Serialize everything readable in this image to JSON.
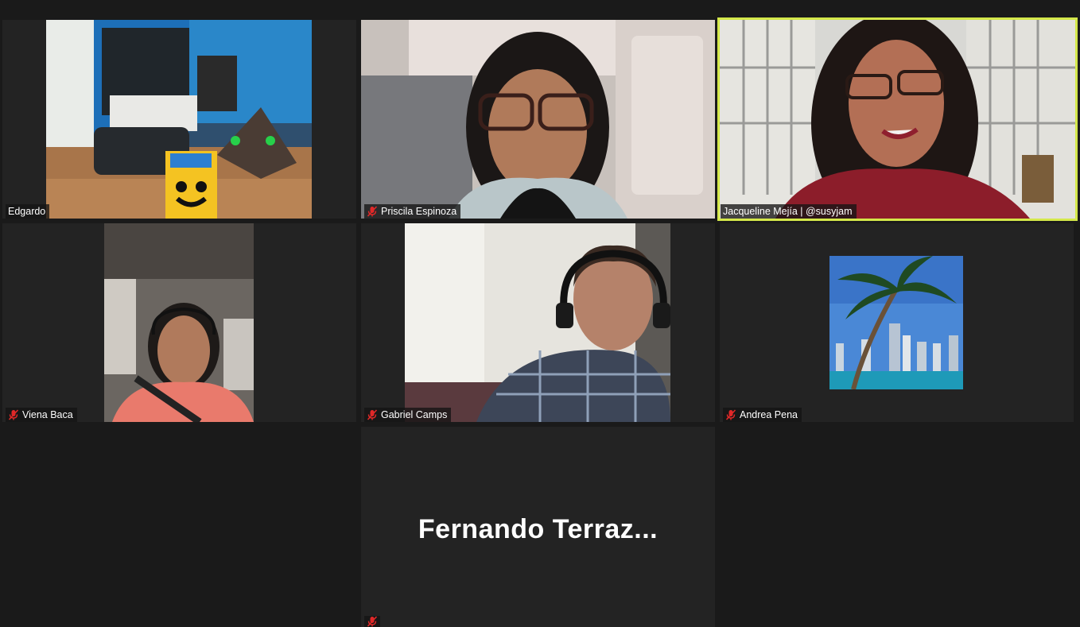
{
  "participants": [
    {
      "name": "Edgardo",
      "muted": false
    },
    {
      "name": "Priscila Espinoza",
      "muted": true
    },
    {
      "name": "Jacqueline Mejía | @susyjam",
      "muted": false,
      "active_speaker": true
    },
    {
      "name": "Viena Baca",
      "muted": true
    },
    {
      "name": "Gabriel Camps",
      "muted": true
    },
    {
      "name": "Andrea Pena",
      "muted": true
    },
    {
      "name": "Fernando  Terraz...",
      "muted": true,
      "video_off": true
    }
  ],
  "colors": {
    "background": "#1a1a1a",
    "tile": "#232323",
    "active_speaker_border": "#d4e84a",
    "muted_icon": "#e02828"
  },
  "icons": {
    "muted": "microphone-muted-icon"
  }
}
